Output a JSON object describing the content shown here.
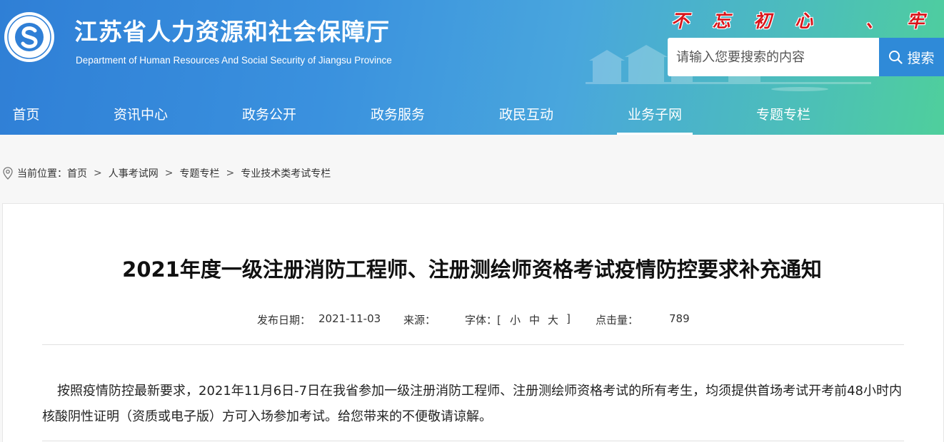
{
  "header": {
    "site_title": "江苏省人力资源和社会保障厅",
    "site_subtitle": "Department of Human Resources And Social Security of Jiangsu Province",
    "slogan": "不 忘 初 心   、 牢 记 使 命",
    "search": {
      "placeholder": "请输入您要搜索的内容",
      "button_label": "搜索"
    }
  },
  "nav": {
    "items": [
      {
        "label": "首页"
      },
      {
        "label": "资讯中心"
      },
      {
        "label": "政务公开"
      },
      {
        "label": "政务服务"
      },
      {
        "label": "政民互动"
      },
      {
        "label": "业务子网",
        "active": true
      },
      {
        "label": "专题专栏"
      }
    ]
  },
  "breadcrumb": {
    "prefix": "当前位置：",
    "items": [
      "首页",
      "人事考试网",
      "专题专栏",
      "专业技术类考试专栏"
    ],
    "separator": ">"
  },
  "article": {
    "title": "2021年度一级注册消防工程师、注册测绘师资格考试疫情防控要求补充通知",
    "meta": {
      "date_label": "发布日期：",
      "date": "2021-11-03",
      "source_label": "来源：",
      "font_label": "字体：[",
      "font_small": "小",
      "font_medium": "中",
      "font_large": "大",
      "font_close": "]",
      "views_label": "点击量：",
      "views": "789"
    },
    "body": "按照疫情防控最新要求，2021年11月6日-7日在我省参加一级注册消防工程师、注册测绘师资格考试的所有考生，均须提供首场考试开考前48小时内核酸阴性证明（资质或电子版）方可入场参加考试。给您带来的不便敬请谅解。"
  },
  "colors": {
    "header_gradient_start": "#2f7fd6",
    "header_gradient_end": "#4fcf9c",
    "slogan": "#d9151b",
    "search_button": "#2f8ad8"
  }
}
